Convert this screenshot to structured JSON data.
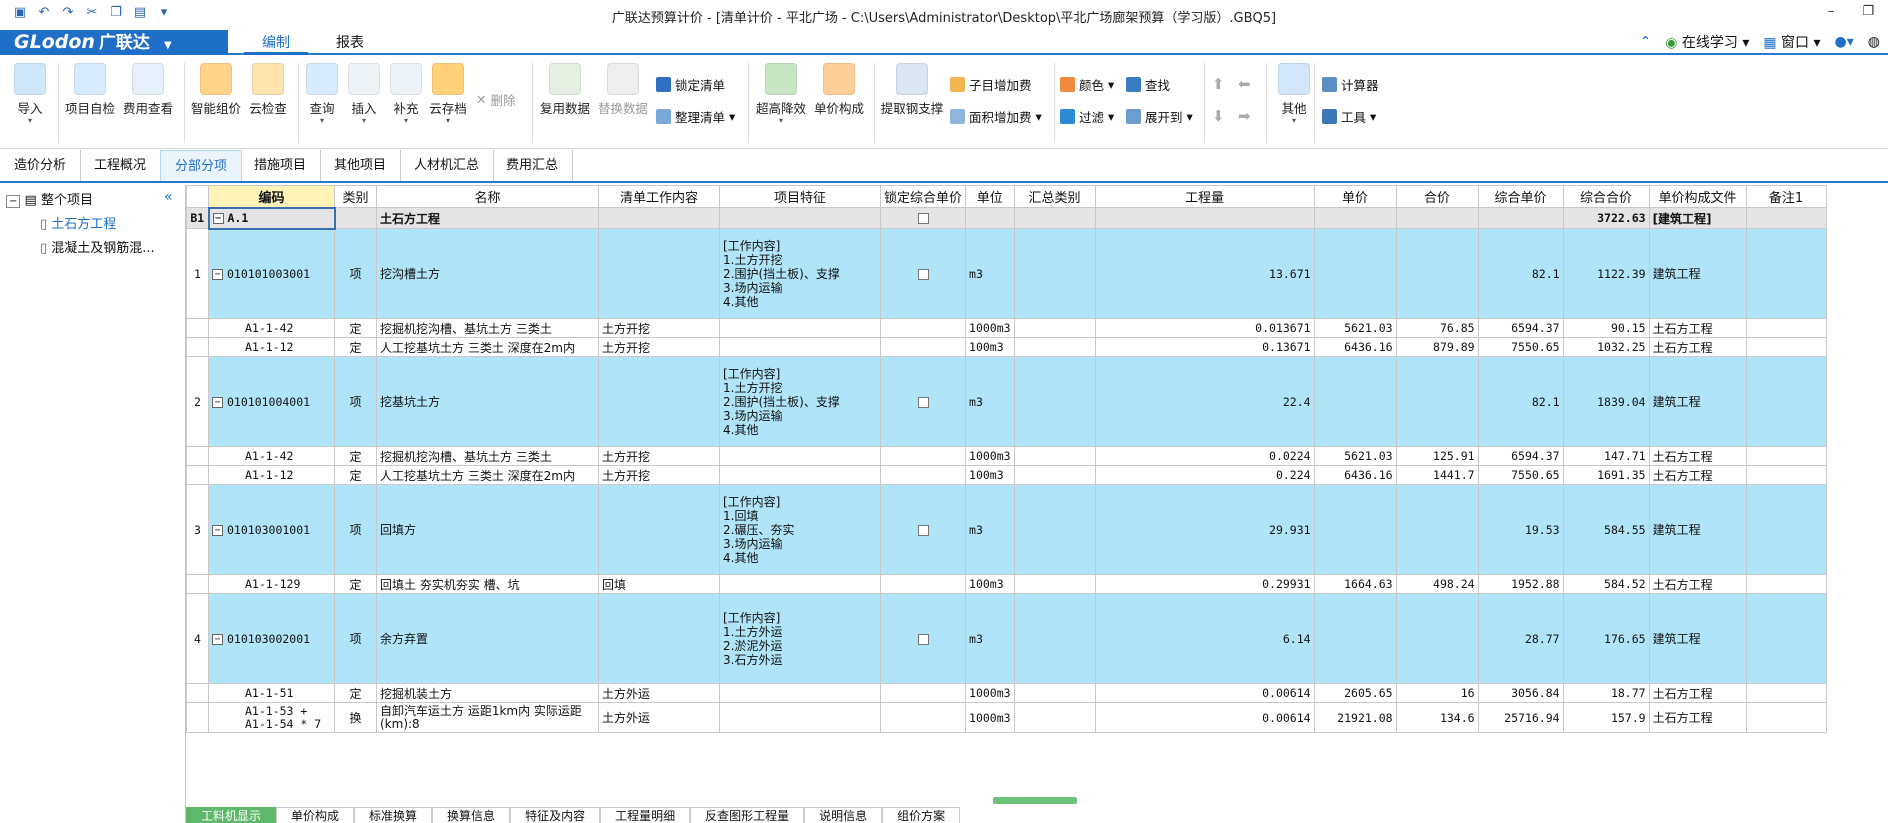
{
  "window": {
    "title": "广联达预算计价 - [清单计价 - 平北广场 - C:\\Users\\Administrator\\Desktop\\平北广场廊架预算（学习版）.GBQ5]"
  },
  "brand": {
    "logo": "GLodon",
    "logo_cn": "广联达",
    "logo_arrow": "▼"
  },
  "menu_tabs": [
    "编制",
    "报表"
  ],
  "right_menu": {
    "learn": "在线学习",
    "window": "窗口"
  },
  "ribbon": {
    "import": "导入",
    "self_check": "项目自检",
    "fee_view": "费用查看",
    "smart_price": "智能组价",
    "cloud_check": "云检查",
    "query": "查询",
    "insert": "插入",
    "supplement": "补充",
    "cloud_save": "云存档",
    "delete": "删除",
    "reuse": "复用数据",
    "replace": "替换数据",
    "lock_list": "锁定清单",
    "tidy_list": "整理清单",
    "super_height": "超高降效",
    "unit_comp": "单价构成",
    "extract_support": "提取钢支撑",
    "sub_fee": "子目增加费",
    "area_fee": "面积增加费",
    "color": "颜色",
    "find": "查找",
    "filter": "过滤",
    "expand": "展开到",
    "other": "其他",
    "calculator": "计算器",
    "tools": "工具"
  },
  "sub_tabs": [
    "造价分析",
    "工程概况",
    "分部分项",
    "措施项目",
    "其他项目",
    "人材机汇总",
    "费用汇总"
  ],
  "tree": {
    "root": "整个项目",
    "items": [
      "土石方工程",
      "混凝土及钢筋混..."
    ]
  },
  "columns": [
    "编码",
    "类别",
    "名称",
    "清单工作内容",
    "项目特征",
    "锁定综合单价",
    "单位",
    "汇总类别",
    "工程量",
    "单价",
    "合价",
    "综合单价",
    "综合合价",
    "单价构成文件",
    "备注1"
  ],
  "head_row": {
    "idx": "B1",
    "code": "A.1",
    "name": "土石方工程",
    "total": "3722.63",
    "file": "[建筑工程]"
  },
  "rows": [
    {
      "kind": "qd",
      "idx": "1",
      "code": "010101003001",
      "type": "项",
      "name": "挖沟槽土方",
      "feature": "[工作内容]\n1.土方开挖\n2.围护(挡土板)、支撑\n3.场内运输\n4.其他",
      "unit": "m3",
      "qty": "13.671",
      "uprice": "82.1",
      "utotal": "1122.39",
      "file": "建筑工程"
    },
    {
      "kind": "de",
      "code": "A1-1-42",
      "type": "定",
      "name": "挖掘机挖沟槽、基坑土方 三类土",
      "work": "土方开挖",
      "unit": "1000m3",
      "qty": "0.013671",
      "price": "5621.03",
      "total": "76.85",
      "uprice": "6594.37",
      "utotal": "90.15",
      "file": "土石方工程"
    },
    {
      "kind": "de",
      "code": "A1-1-12",
      "type": "定",
      "name": "人工挖基坑土方 三类土 深度在2m内",
      "work": "土方开挖",
      "unit": "100m3",
      "qty": "0.13671",
      "price": "6436.16",
      "total": "879.89",
      "uprice": "7550.65",
      "utotal": "1032.25",
      "file": "土石方工程"
    },
    {
      "kind": "qd",
      "idx": "2",
      "code": "010101004001",
      "type": "项",
      "name": "挖基坑土方",
      "feature": "[工作内容]\n1.土方开挖\n2.围护(挡土板)、支撑\n3.场内运输\n4.其他",
      "unit": "m3",
      "qty": "22.4",
      "uprice": "82.1",
      "utotal": "1839.04",
      "file": "建筑工程"
    },
    {
      "kind": "de",
      "code": "A1-1-42",
      "type": "定",
      "name": "挖掘机挖沟槽、基坑土方 三类土",
      "work": "土方开挖",
      "unit": "1000m3",
      "qty": "0.0224",
      "price": "5621.03",
      "total": "125.91",
      "uprice": "6594.37",
      "utotal": "147.71",
      "file": "土石方工程"
    },
    {
      "kind": "de",
      "code": "A1-1-12",
      "type": "定",
      "name": "人工挖基坑土方 三类土 深度在2m内",
      "work": "土方开挖",
      "unit": "100m3",
      "qty": "0.224",
      "price": "6436.16",
      "total": "1441.7",
      "uprice": "7550.65",
      "utotal": "1691.35",
      "file": "土石方工程"
    },
    {
      "kind": "qd",
      "idx": "3",
      "code": "010103001001",
      "type": "项",
      "name": "回填方",
      "feature": "[工作内容]\n1.回填\n2.碾压、夯实\n3.场内运输\n4.其他",
      "unit": "m3",
      "qty": "29.931",
      "uprice": "19.53",
      "utotal": "584.55",
      "file": "建筑工程"
    },
    {
      "kind": "de",
      "code": "A1-1-129",
      "type": "定",
      "name": "回填土 夯实机夯实 槽、坑",
      "work": "回填",
      "unit": "100m3",
      "qty": "0.29931",
      "price": "1664.63",
      "total": "498.24",
      "uprice": "1952.88",
      "utotal": "584.52",
      "file": "土石方工程"
    },
    {
      "kind": "qd",
      "idx": "4",
      "code": "010103002001",
      "type": "项",
      "name": "余方弃置",
      "feature": "[工作内容]\n1.土方外运\n2.淤泥外运\n3.石方外运",
      "unit": "m3",
      "qty": "6.14",
      "uprice": "28.77",
      "utotal": "176.65",
      "file": "建筑工程"
    },
    {
      "kind": "de",
      "code": "A1-1-51",
      "type": "定",
      "name": "挖掘机装土方",
      "work": "土方外运",
      "unit": "1000m3",
      "qty": "0.00614",
      "price": "2605.65",
      "total": "16",
      "uprice": "3056.84",
      "utotal": "18.77",
      "file": "土石方工程"
    },
    {
      "kind": "de",
      "tall": true,
      "code": "A1-1-53 + A1-1-54 * 7",
      "type": "换",
      "name": "自卸汽车运土方 运距1km内  实际运距(km):8",
      "work": "土方外运",
      "unit": "1000m3",
      "qty": "0.00614",
      "price": "21921.08",
      "total": "134.6",
      "uprice": "25716.94",
      "utotal": "157.9",
      "file": "土石方工程"
    }
  ],
  "bottom_tabs": [
    "工料机显示",
    "单价构成",
    "标准换算",
    "换算信息",
    "特征及内容",
    "工程量明细",
    "反查图形工程量",
    "说明信息",
    "组价方案"
  ],
  "colors": {
    "accent": "#1f6fc9",
    "qd_row": "#b0e4f8",
    "head_row": "#e4e4e4",
    "active_bottom": "#5db86a"
  }
}
